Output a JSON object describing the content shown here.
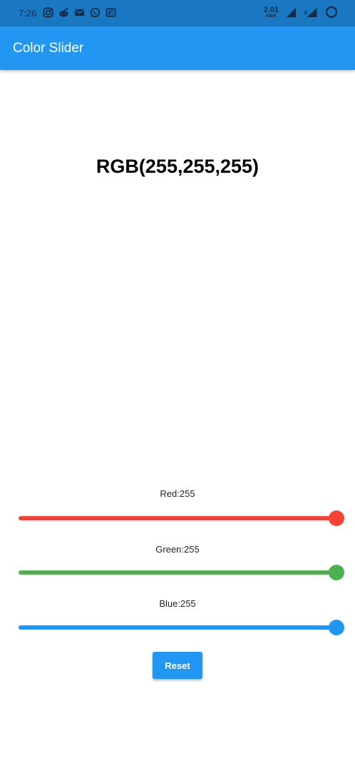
{
  "status_bar": {
    "time": "7:26",
    "net_speed_value": "2.01",
    "net_speed_unit": "KB/S",
    "icons": [
      "instagram-icon",
      "reddit-icon",
      "mail-icon",
      "whatsapp-icon",
      "news-icon"
    ],
    "right_icons": [
      "signal-icon",
      "signal-4g-icon",
      "battery-ring-icon"
    ]
  },
  "app_bar": {
    "title": "Color Slider"
  },
  "display": {
    "rgb_text": "RGB(255,255,255)"
  },
  "sliders": [
    {
      "label": "Red:255",
      "value": 255,
      "max": 255,
      "color": "#f44336"
    },
    {
      "label": "Green:255",
      "value": 255,
      "max": 255,
      "color": "#4caf50"
    },
    {
      "label": "Blue:255",
      "value": 255,
      "max": 255,
      "color": "#2196f3"
    }
  ],
  "reset_button": {
    "label": "Reset"
  },
  "colors": {
    "status_bar": "#1a78c2",
    "app_bar": "#2196f3",
    "background": "#ffffff"
  }
}
